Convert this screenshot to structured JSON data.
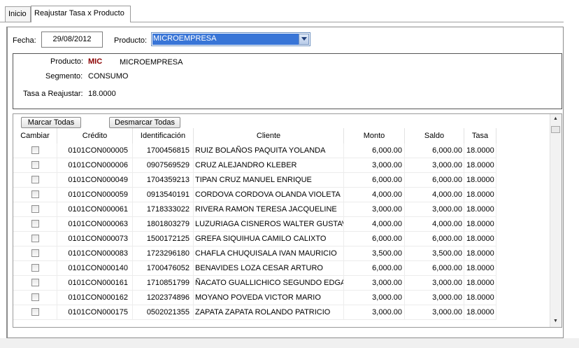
{
  "tabs": [
    {
      "label": "Inicio",
      "active": false
    },
    {
      "label": "Reajustar Tasa x Producto",
      "active": true
    }
  ],
  "form": {
    "fecha_label": "Fecha:",
    "fecha_value": "29/08/2012",
    "producto_label": "Producto:",
    "producto_value": "MICROEMPRESA"
  },
  "info": {
    "producto_label": "Producto:",
    "producto_code": "MIC",
    "producto_name": "MICROEMPRESA",
    "segmento_label": "Segmento:",
    "segmento_value": "CONSUMO",
    "tasa_label": "Tasa a Reajustar:",
    "tasa_value": "18.0000"
  },
  "grid": {
    "marcar_label": "Marcar Todas",
    "desmarcar_label": "Desmarcar Todas",
    "columns": [
      "Cambiar",
      "Crédito",
      "Identificación",
      "Cliente",
      "Monto",
      "Saldo",
      "Tasa"
    ],
    "rows": [
      {
        "credito": "0101CON000005",
        "id": "1700456815",
        "cliente": "RUIZ BOLAÑOS PAQUITA YOLANDA",
        "monto": "6,000.00",
        "saldo": "6,000.00",
        "tasa": "18.0000"
      },
      {
        "credito": "0101CON000006",
        "id": "0907569529",
        "cliente": "CRUZ ALEJANDRO KLEBER",
        "monto": "3,000.00",
        "saldo": "3,000.00",
        "tasa": "18.0000"
      },
      {
        "credito": "0101CON000049",
        "id": "1704359213",
        "cliente": "TIPAN CRUZ MANUEL ENRIQUE",
        "monto": "6,000.00",
        "saldo": "6,000.00",
        "tasa": "18.0000"
      },
      {
        "credito": "0101CON000059",
        "id": "0913540191",
        "cliente": "CORDOVA CORDOVA OLANDA VIOLETA",
        "monto": "4,000.00",
        "saldo": "4,000.00",
        "tasa": "18.0000"
      },
      {
        "credito": "0101CON000061",
        "id": "1718333022",
        "cliente": "RIVERA RAMON TERESA JACQUELINE",
        "monto": "3,000.00",
        "saldo": "3,000.00",
        "tasa": "18.0000"
      },
      {
        "credito": "0101CON000063",
        "id": "1801803279",
        "cliente": "LUZURIAGA CISNEROS WALTER GUSTAVO",
        "monto": "4,000.00",
        "saldo": "4,000.00",
        "tasa": "18.0000"
      },
      {
        "credito": "0101CON000073",
        "id": "1500172125",
        "cliente": "GREFA SIQUIHUA CAMILO CALIXTO",
        "monto": "6,000.00",
        "saldo": "6,000.00",
        "tasa": "18.0000"
      },
      {
        "credito": "0101CON000083",
        "id": "1723296180",
        "cliente": "CHAFLA CHUQUISALA IVAN MAURICIO",
        "monto": "3,500.00",
        "saldo": "3,500.00",
        "tasa": "18.0000"
      },
      {
        "credito": "0101CON000140",
        "id": "1700476052",
        "cliente": "BENAVIDES LOZA CESAR ARTURO",
        "monto": "6,000.00",
        "saldo": "6,000.00",
        "tasa": "18.0000"
      },
      {
        "credito": "0101CON000161",
        "id": "1710851799",
        "cliente": "ÑACATO GUALLICHICO SEGUNDO EDGAR",
        "monto": "3,000.00",
        "saldo": "3,000.00",
        "tasa": "18.0000"
      },
      {
        "credito": "0101CON000162",
        "id": "1202374896",
        "cliente": "MOYANO POVEDA VICTOR MARIO",
        "monto": "3,000.00",
        "saldo": "3,000.00",
        "tasa": "18.0000"
      },
      {
        "credito": "0101CON000175",
        "id": "0502021355",
        "cliente": "ZAPATA ZAPATA ROLANDO PATRICIO",
        "monto": "3,000.00",
        "saldo": "3,000.00",
        "tasa": "18.0000"
      }
    ]
  },
  "colors": {
    "product_code": "#8b0000",
    "selection": "#3875d7"
  }
}
